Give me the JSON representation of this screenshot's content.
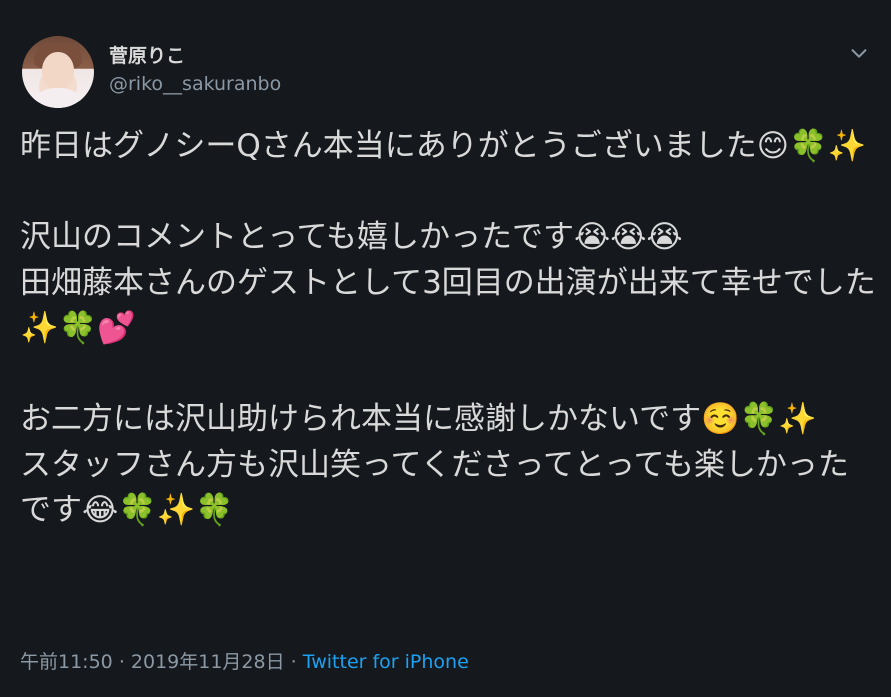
{
  "tweet": {
    "display_name": "菅原りこ",
    "handle": "@riko__sakuranbo",
    "text": "昨日はグノシーQさん本当にありがとうございました😊🍀✨\n\n沢山のコメントとっても嬉しかったです😭😭😭\n田畑藤本さんのゲストとして3回目の出演が出来て幸せでした✨🍀💕\n\nお二方には沢山助けられ本当に感謝しかないです☺️🍀✨\nスタッフさん方も沢山笑ってくださってとっても楽しかったです😂🍀✨🍀",
    "time": "午前11:50",
    "separator": "·",
    "date": "2019年11月28日",
    "source": "Twitter for iPhone"
  },
  "icons": {
    "menu": "chevron-down-icon",
    "avatar": "profile-photo"
  },
  "colors": {
    "background": "#15181c",
    "text": "#d9d9d9",
    "secondary": "#8b98a5",
    "link": "#1da1f2"
  }
}
